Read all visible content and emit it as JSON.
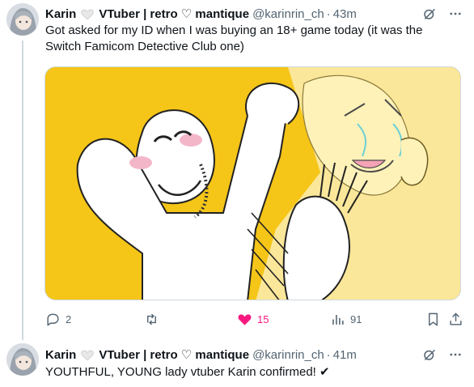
{
  "tweets": [
    {
      "display_name": "Karin",
      "name_suffix": "VTuber | retro ♡ mantique",
      "handle": "@karinrin_ch",
      "separator": "·",
      "time": "43m",
      "text": "Got asked for my ID when I was buying an 18+ game today (it was the Switch Famicom Detective Club one)",
      "stats": {
        "replies": "2",
        "retweets": "",
        "likes": "15",
        "views": "91"
      },
      "liked": true
    },
    {
      "display_name": "Karin",
      "name_suffix": "VTuber | retro ♡ mantique",
      "handle": "@karinrin_ch",
      "separator": "·",
      "time": "41m",
      "text": "YOUTHFUL, YOUNG lady vtuber Karin confirmed! ✔"
    }
  ],
  "colors": {
    "like_active": "#f91880",
    "muted": "#536471",
    "media_bg": "#f5c518"
  },
  "icons": [
    "heart-emoji-icon",
    "grok-icon",
    "more-icon",
    "reply-icon",
    "retweet-icon",
    "like-icon",
    "views-icon",
    "bookmark-icon",
    "share-icon"
  ]
}
